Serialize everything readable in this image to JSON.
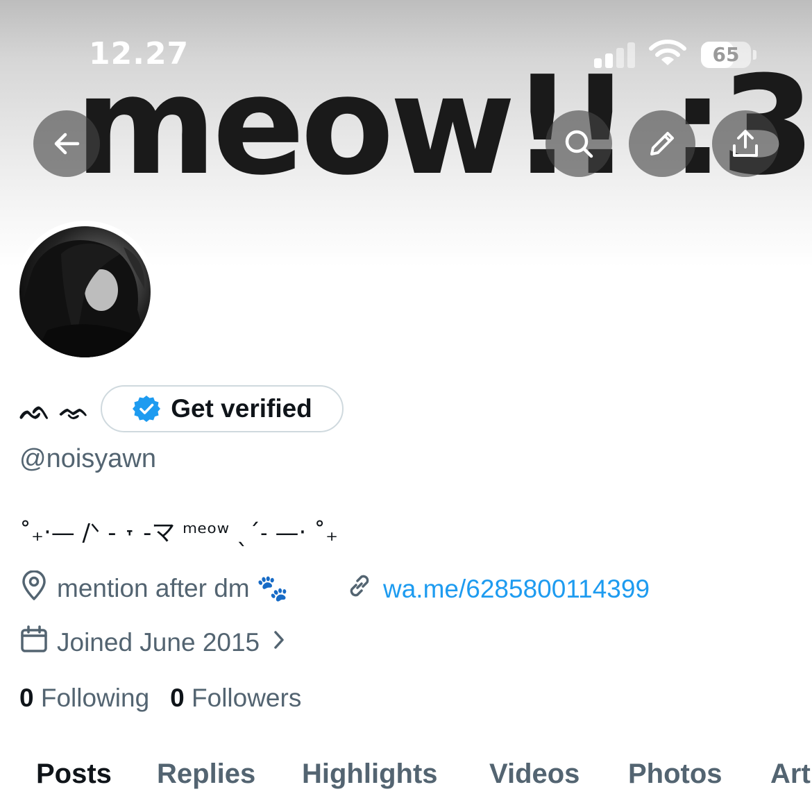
{
  "status_bar": {
    "time": "12.27",
    "battery": "65",
    "battery_level": 0.65
  },
  "banner": {
    "text": "meow!! :3"
  },
  "header_icons": [
    "arrow-left-icon",
    "search-icon",
    "pencil-icon",
    "share-icon"
  ],
  "profile": {
    "display_name": "ᨒ ᨎ",
    "verify_label": "Get verified",
    "handle": "@noisyawn",
    "bio": "˚₊‧— /ᐠ - ˕ -マ ᵐᵉᵒʷ ˎˊ˗ —‧ ˚₊",
    "location": "mention after dm 🐾",
    "link": "wa.me/6285800114399",
    "joined": "Joined June 2015",
    "following_count": "0",
    "following_label": "Following",
    "followers_count": "0",
    "followers_label": "Followers"
  },
  "tabs": [
    "Posts",
    "Replies",
    "Highlights",
    "Videos",
    "Photos",
    "Art"
  ],
  "colors": {
    "accent": "#1d9bf0",
    "secondary_text": "#536471",
    "primary_text": "#0f1419"
  }
}
